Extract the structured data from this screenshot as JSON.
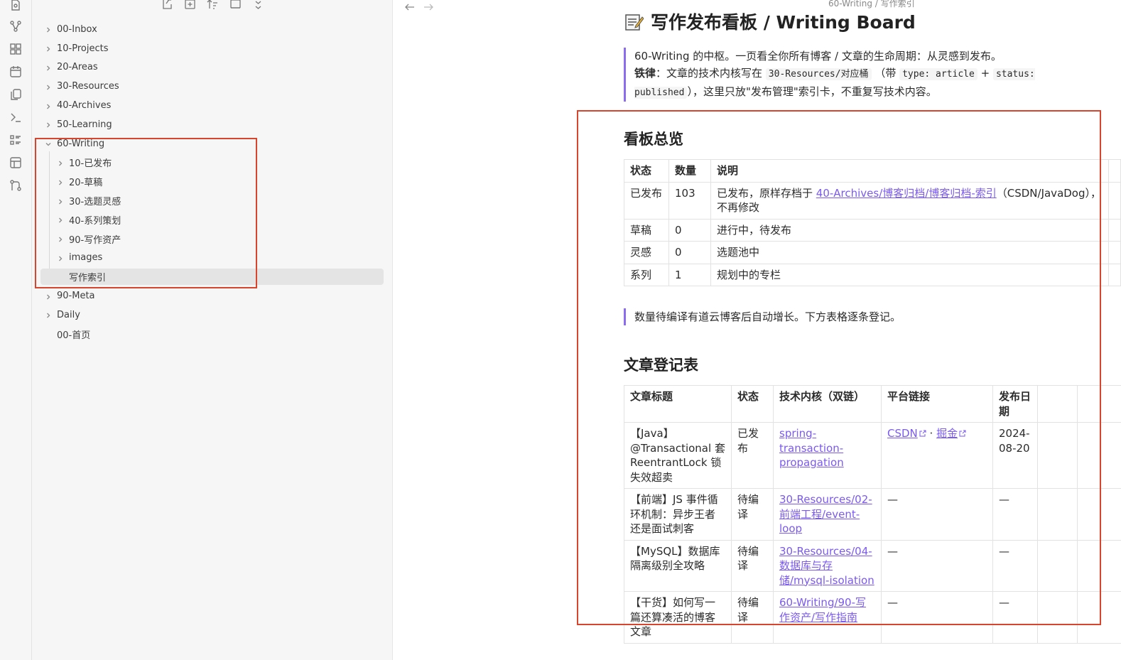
{
  "ribbon": {
    "icons": [
      "new-note-icon",
      "graph-icon",
      "grid-icon",
      "calendar-icon",
      "copy-icon",
      "terminal-icon",
      "list-icon",
      "table-icon",
      "git-icon"
    ]
  },
  "sidebar": {
    "toolbar": [
      "new-note-icon",
      "new-folder-icon",
      "sort-icon",
      "collapse-icon",
      "close-icon"
    ],
    "tree": [
      {
        "label": "00-Inbox",
        "level": 0,
        "chevron": "right"
      },
      {
        "label": "10-Projects",
        "level": 0,
        "chevron": "right"
      },
      {
        "label": "20-Areas",
        "level": 0,
        "chevron": "right"
      },
      {
        "label": "30-Resources",
        "level": 0,
        "chevron": "right"
      },
      {
        "label": "40-Archives",
        "level": 0,
        "chevron": "right"
      },
      {
        "label": "50-Learning",
        "level": 0,
        "chevron": "right"
      },
      {
        "label": "60-Writing",
        "level": 0,
        "chevron": "down"
      },
      {
        "label": "10-已发布",
        "level": 1,
        "chevron": "right"
      },
      {
        "label": "20-草稿",
        "level": 1,
        "chevron": "right"
      },
      {
        "label": "30-选题灵感",
        "level": 1,
        "chevron": "right"
      },
      {
        "label": "40-系列策划",
        "level": 1,
        "chevron": "right"
      },
      {
        "label": "90-写作资产",
        "level": 1,
        "chevron": "right"
      },
      {
        "label": "images",
        "level": 1,
        "chevron": "right"
      },
      {
        "label": "写作索引",
        "level": 1,
        "chevron": "none",
        "active": true
      },
      {
        "label": "90-Meta",
        "level": 0,
        "chevron": "right"
      },
      {
        "label": "Daily",
        "level": 0,
        "chevron": "right"
      },
      {
        "label": "00-首页",
        "level": 0,
        "chevron": "none"
      }
    ]
  },
  "editor": {
    "breadcrumb": "60-Writing / 写作索引",
    "title": "写作发布看板 / Writing Board",
    "intro_line1": "60-Writing 的中枢。一页看全你所有博客 / 文章的生命周期：从灵感到发布。",
    "intro_bold": "铁律",
    "intro_mid": "：文章的技术内核写在 ",
    "intro_code1": "30-Resources/对应桶",
    "intro_mid2": " （带 ",
    "intro_code2": "type: article",
    "intro_plus": " + ",
    "intro_code3": "status: published",
    "intro_end": "），这里只放\"发布管理\"索引卡，不重复写技术内容。",
    "overview_heading": "看板总览",
    "overview_headers": [
      "状态",
      "数量",
      "说明"
    ],
    "overview_rows": [
      {
        "status": "已发布",
        "count": "103",
        "desc_pre": "已发布，原样存档于 ",
        "link": "40-Archives/博客归档/博客归档-索引",
        "desc_post": "（CSDN/JavaDog），不再修改"
      },
      {
        "status": "草稿",
        "count": "0",
        "desc_pre": "进行中，待发布",
        "link": "",
        "desc_post": ""
      },
      {
        "status": "灵感",
        "count": "0",
        "desc_pre": "选题池中",
        "link": "",
        "desc_post": ""
      },
      {
        "status": "系列",
        "count": "1",
        "desc_pre": "规划中的专栏",
        "link": "",
        "desc_post": ""
      }
    ],
    "note": "数量待编译有道云博客后自动增长。下方表格逐条登记。",
    "register_heading": "文章登记表",
    "register_headers": [
      "文章标题",
      "状态",
      "技术内核（双链）",
      "平台链接",
      "发布日期"
    ],
    "register_rows": [
      {
        "title": "【Java】@Transactional 套 ReentrantLock 锁失效超卖",
        "status": "已发布",
        "core": "spring-transaction-propagation",
        "platform1": "CSDN",
        "platform2": "掘金",
        "date": "2024-08-20"
      },
      {
        "title": "【前端】JS 事件循环机制：异步王者还是面试刺客",
        "status": "待编译",
        "core": "30-Resources/02-前端工程/event-loop",
        "platform1": "—",
        "platform2": "",
        "date": "—"
      },
      {
        "title": "【MySQL】数据库隔离级别全攻略",
        "status": "待编译",
        "core": "30-Resources/04-数据库与存储/mysql-isolation",
        "platform1": "—",
        "platform2": "",
        "date": "—"
      },
      {
        "title": "【干货】如何写一篇还算凑活的博客文章",
        "status": "待编译",
        "core": "60-Writing/90-写作资产/写作指南",
        "platform1": "—",
        "platform2": "",
        "date": "—"
      }
    ]
  },
  "highlight_color": "#d8452f",
  "link_color": "#7a5af0"
}
